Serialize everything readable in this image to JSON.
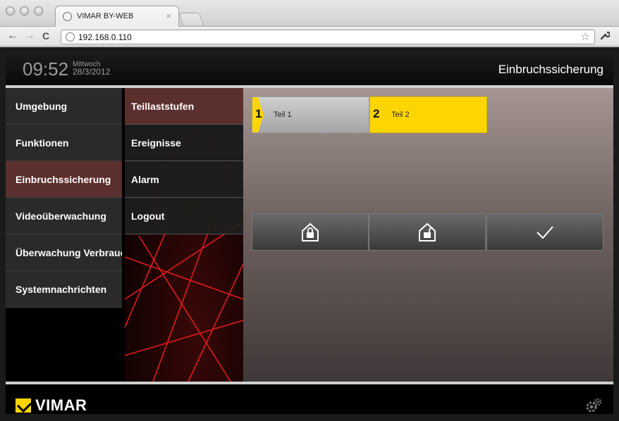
{
  "browser": {
    "tab_title": "VIMAR BY-WEB",
    "tab_close": "×",
    "url": "192.168.0.110",
    "back": "←",
    "forward": "→",
    "reload": "C",
    "star": "☆",
    "wrench": "🔧"
  },
  "header": {
    "time": "09:52",
    "weekday": "Mittwoch",
    "date": "28/3/2012",
    "title": "Einbruchssicherung"
  },
  "menu": {
    "items": [
      {
        "label": "Umgebung"
      },
      {
        "label": "Funktionen"
      },
      {
        "label": "Einbruchssicherung"
      },
      {
        "label": "Videoüberwachung"
      },
      {
        "label": "Überwachung Verbrauch"
      },
      {
        "label": "Systemnachrichten"
      }
    ],
    "active_index": 2
  },
  "submenu": {
    "items": [
      {
        "label": "Teillaststufen"
      },
      {
        "label": "Ereignisse"
      },
      {
        "label": "Alarm"
      },
      {
        "label": "Logout"
      }
    ],
    "active_index": 0
  },
  "parts": [
    {
      "number": "1",
      "label": "Teil 1",
      "selected": false
    },
    {
      "number": "2",
      "label": "Teil 2",
      "selected": true
    }
  ],
  "actions": [
    {
      "icon": "lock-house-icon"
    },
    {
      "icon": "unlock-house-icon"
    },
    {
      "icon": "checkmark-icon"
    }
  ],
  "footer": {
    "brand": "VIMAR",
    "settings_icon": "gears-icon"
  },
  "colors": {
    "accent": "#ffd500",
    "active_item": "#5b2f2d"
  }
}
